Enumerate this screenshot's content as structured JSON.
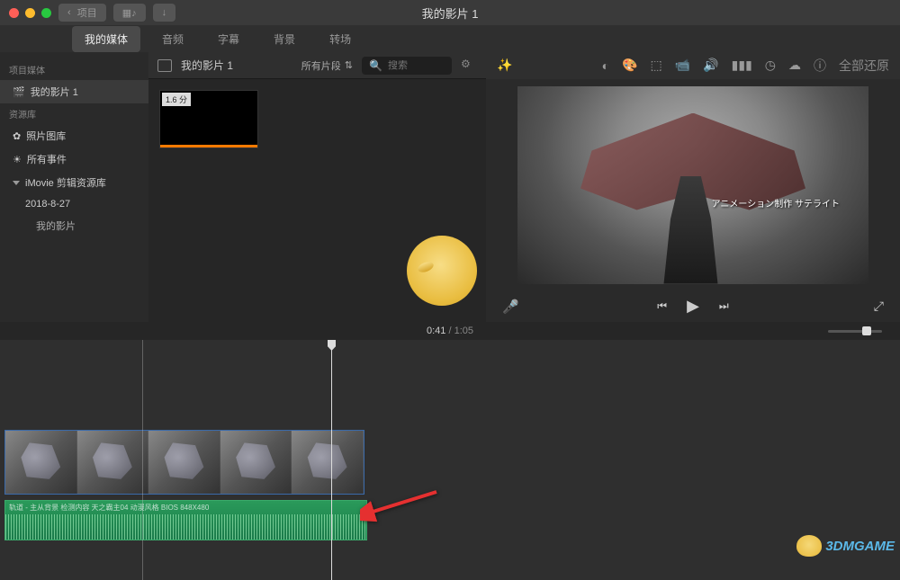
{
  "title": "我的影片 1",
  "toolbar": {
    "back_label": "项目"
  },
  "tabs": {
    "media": "我的媒体",
    "audio": "音频",
    "titles": "字幕",
    "bg": "背景",
    "trans": "转场"
  },
  "sidebar": {
    "project_media_hdr": "项目媒体",
    "project_name": "我的影片 1",
    "library_hdr": "资源库",
    "photos": "照片图库",
    "all_events": "所有事件",
    "imovie_lib": "iMovie 剪辑资源库",
    "date_event": "2018-8-27",
    "my_movie": "我的影片"
  },
  "browser": {
    "name": "我的影片 1",
    "filter": "所有片段",
    "search_ph": "搜索",
    "clip_dur": "1.6 分"
  },
  "preview": {
    "reset": "全部还原",
    "subtitle": "アニメーション制作 サテライト"
  },
  "time": {
    "cur": "0:41",
    "total": "1:05"
  },
  "audio_track_label": "轨道 - 主从背景 检测内容 天之霸主04 动漫风格 BIOS 848X480",
  "watermark": "3DMGAME"
}
